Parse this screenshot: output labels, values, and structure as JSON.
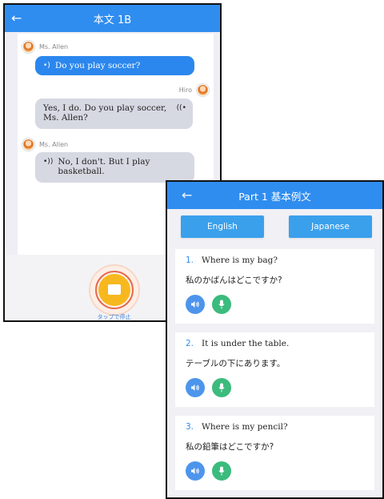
{
  "screen1": {
    "title": "本文 1B",
    "messages": [
      {
        "speaker": "Ms. Allen",
        "icon": "sound-icon",
        "text": "Do you play soccer?"
      },
      {
        "speaker": "Hiro",
        "icon": "sound-icon",
        "text1": "Yes, I do. Do you play soccer,",
        "text2": "Ms. Allen?"
      },
      {
        "speaker": "Ms. Allen",
        "icon": "sound-icon",
        "text1": "No, I don't. But I play",
        "text2": "basketball."
      }
    ],
    "tap_label": "タップで停止"
  },
  "screen2": {
    "title": "Part 1 基本例文",
    "english_button": "English",
    "japanese_button": "Japanese",
    "items": [
      {
        "num": "1.",
        "en": "Where is my bag?",
        "jp": "私のかばんはどこですか?"
      },
      {
        "num": "2.",
        "en": "It is under the table.",
        "jp": "テーブルの下にあります。"
      },
      {
        "num": "3.",
        "en": "Where is my pencil?",
        "jp": "私の鉛筆はどこですか?"
      }
    ]
  },
  "colors": {
    "header_blue": "#2f8df0",
    "bubble_blue": "#2b87ee",
    "bubble_grey": "#d6d8e2",
    "lang_button": "#3aa0ec",
    "sound_button": "#4d95ec",
    "mic_button": "#3bbb7d",
    "record_button": "#f7b81f"
  }
}
